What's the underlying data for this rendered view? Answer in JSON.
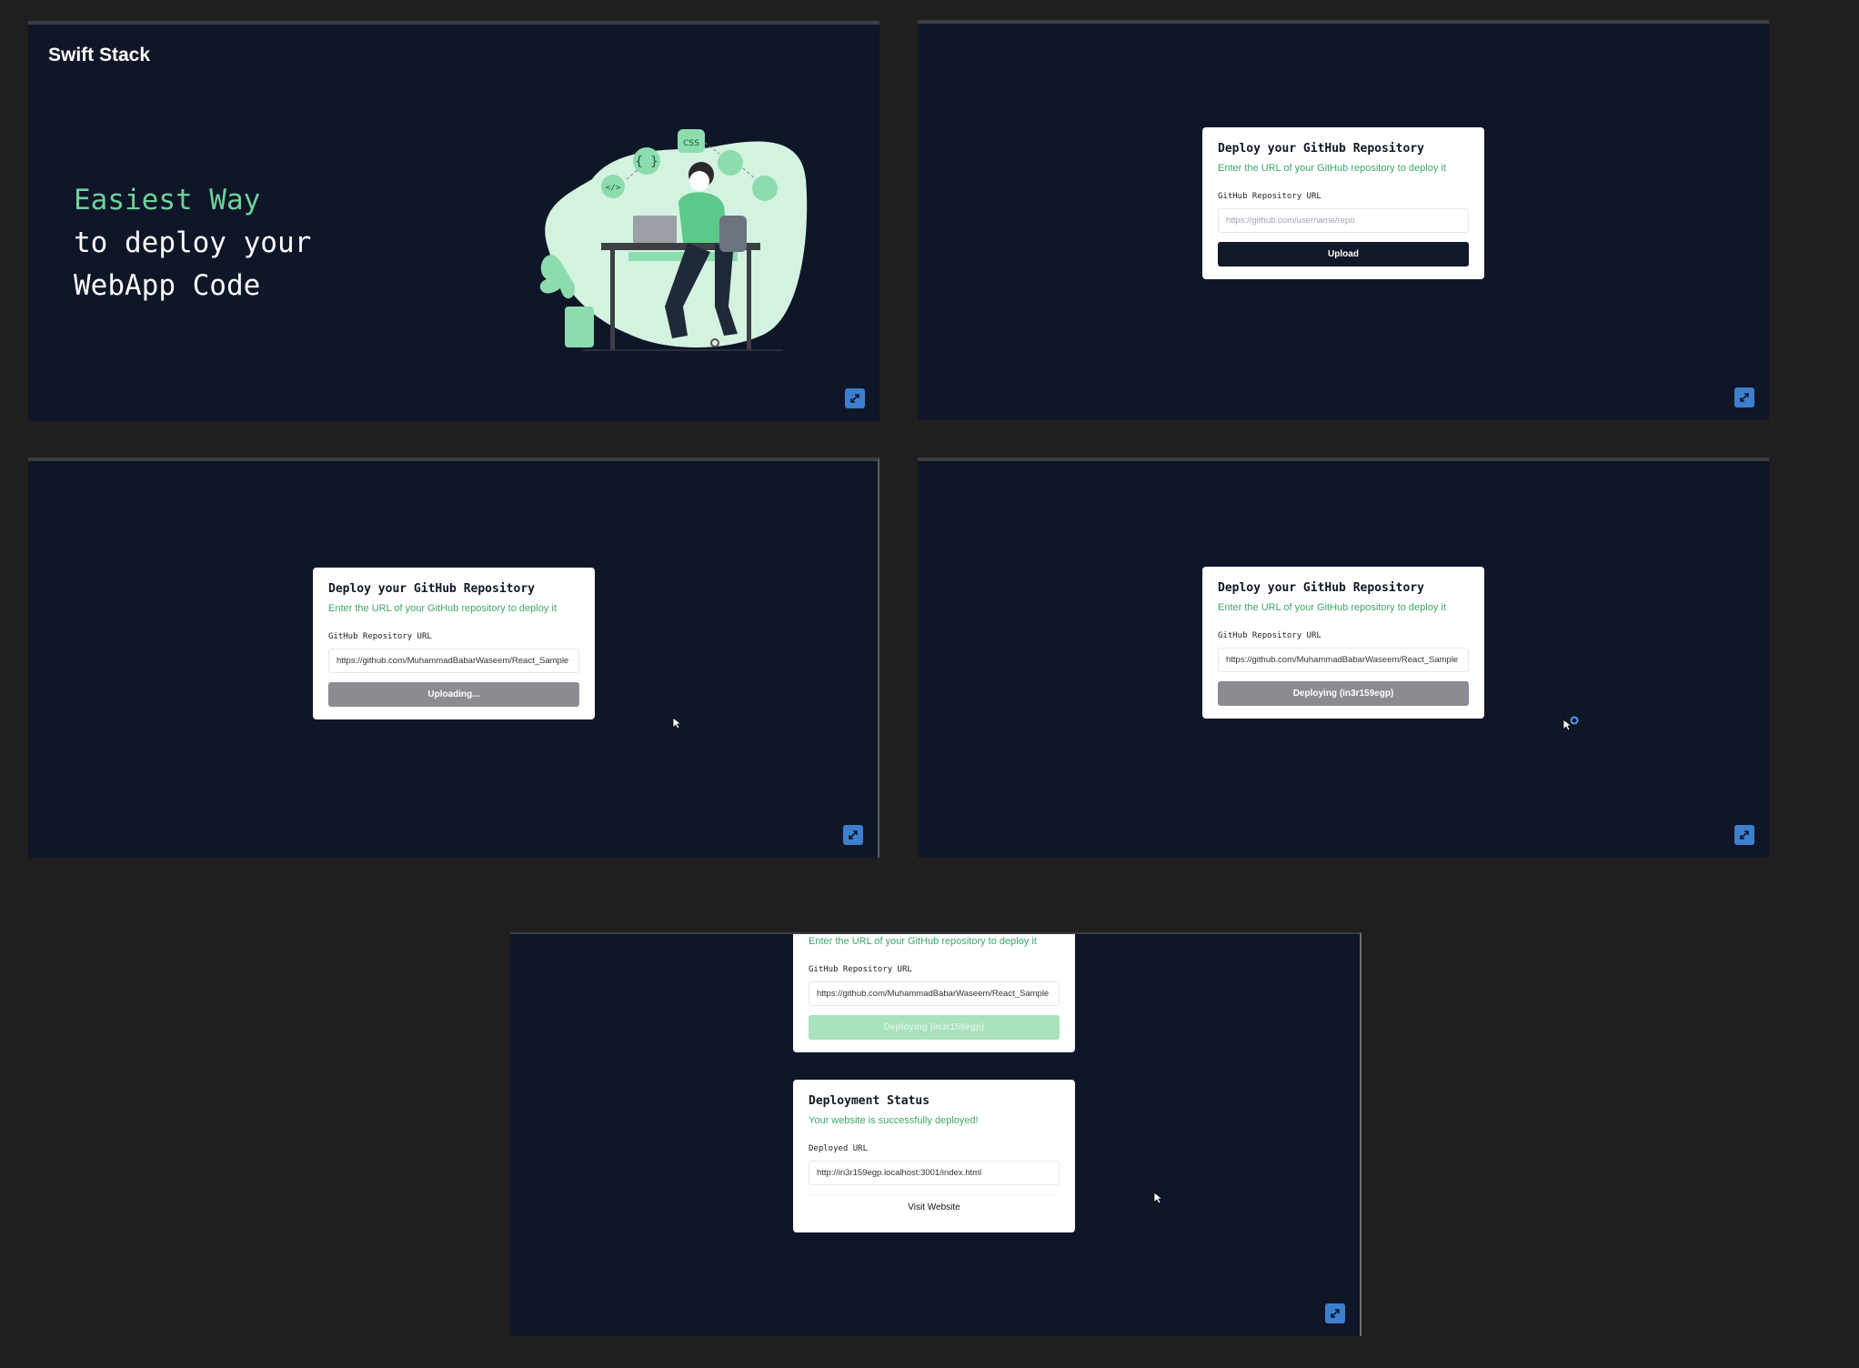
{
  "panel1": {
    "brand": "Swift Stack",
    "hero_line1": "Easiest Way",
    "hero_line2": "to deploy your",
    "hero_line3": "WebApp Code",
    "illustration_badge": "CSS"
  },
  "deploy_form": {
    "title": "Deploy your GitHub Repository",
    "subtitle": "Enter the URL of your GitHub repository to deploy it",
    "field_label": "GitHub Repository URL",
    "placeholder": "https://github.com/username/repo",
    "repo_value": "https://github.com/MuhammadBabarWaseem/React_Sample",
    "upload_label": "Upload",
    "uploading_label": "Uploading...",
    "deploying_label": "Deploying (in3r159egp)",
    "deploying_label_faded": "Deploying (in3r159egp)"
  },
  "status_card": {
    "title": "Deployment Status",
    "subtitle": "Your website is successfully deployed!",
    "field_label": "Deployed URL",
    "url_value": "http://in3r159egp.localhost:3001/index.html",
    "visit_label": "Visit Website"
  },
  "colors": {
    "background": "#1f1f1f",
    "panel": "#0f1628",
    "accent_green": "#6dd39a",
    "dark_button": "#111827",
    "corner_button": "#3d7fcf"
  },
  "icons": [
    "expand-icon",
    "cursor-icon",
    "spinner-icon"
  ]
}
